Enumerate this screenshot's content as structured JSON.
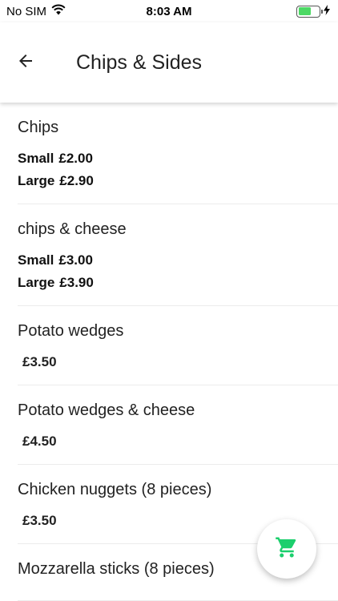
{
  "status_bar": {
    "carrier": "No SIM",
    "time": "8:03 AM"
  },
  "header": {
    "title": "Chips & Sides"
  },
  "colors": {
    "accent": "#1ccf6d",
    "battery": "#4cd964"
  },
  "icons": {
    "back": "arrow-left-icon",
    "cart": "shopping-cart-icon",
    "wifi": "wifi-icon",
    "battery": "battery-icon",
    "charging": "lightning-icon"
  },
  "menu": {
    "items": [
      {
        "name": "Chips",
        "prices": [
          {
            "size": "Small",
            "price": "£2.00"
          },
          {
            "size": "Large",
            "price": "£2.90"
          }
        ]
      },
      {
        "name": "chips & cheese",
        "prices": [
          {
            "size": "Small",
            "price": "£3.00"
          },
          {
            "size": "Large",
            "price": "£3.90"
          }
        ]
      },
      {
        "name": "Potato wedges",
        "price": "£3.50"
      },
      {
        "name": "Potato wedges & cheese",
        "price": "£4.50"
      },
      {
        "name": "Chicken nuggets (8 pieces)",
        "price": "£3.50"
      },
      {
        "name": "Mozzarella sticks (8 pieces)"
      }
    ]
  }
}
